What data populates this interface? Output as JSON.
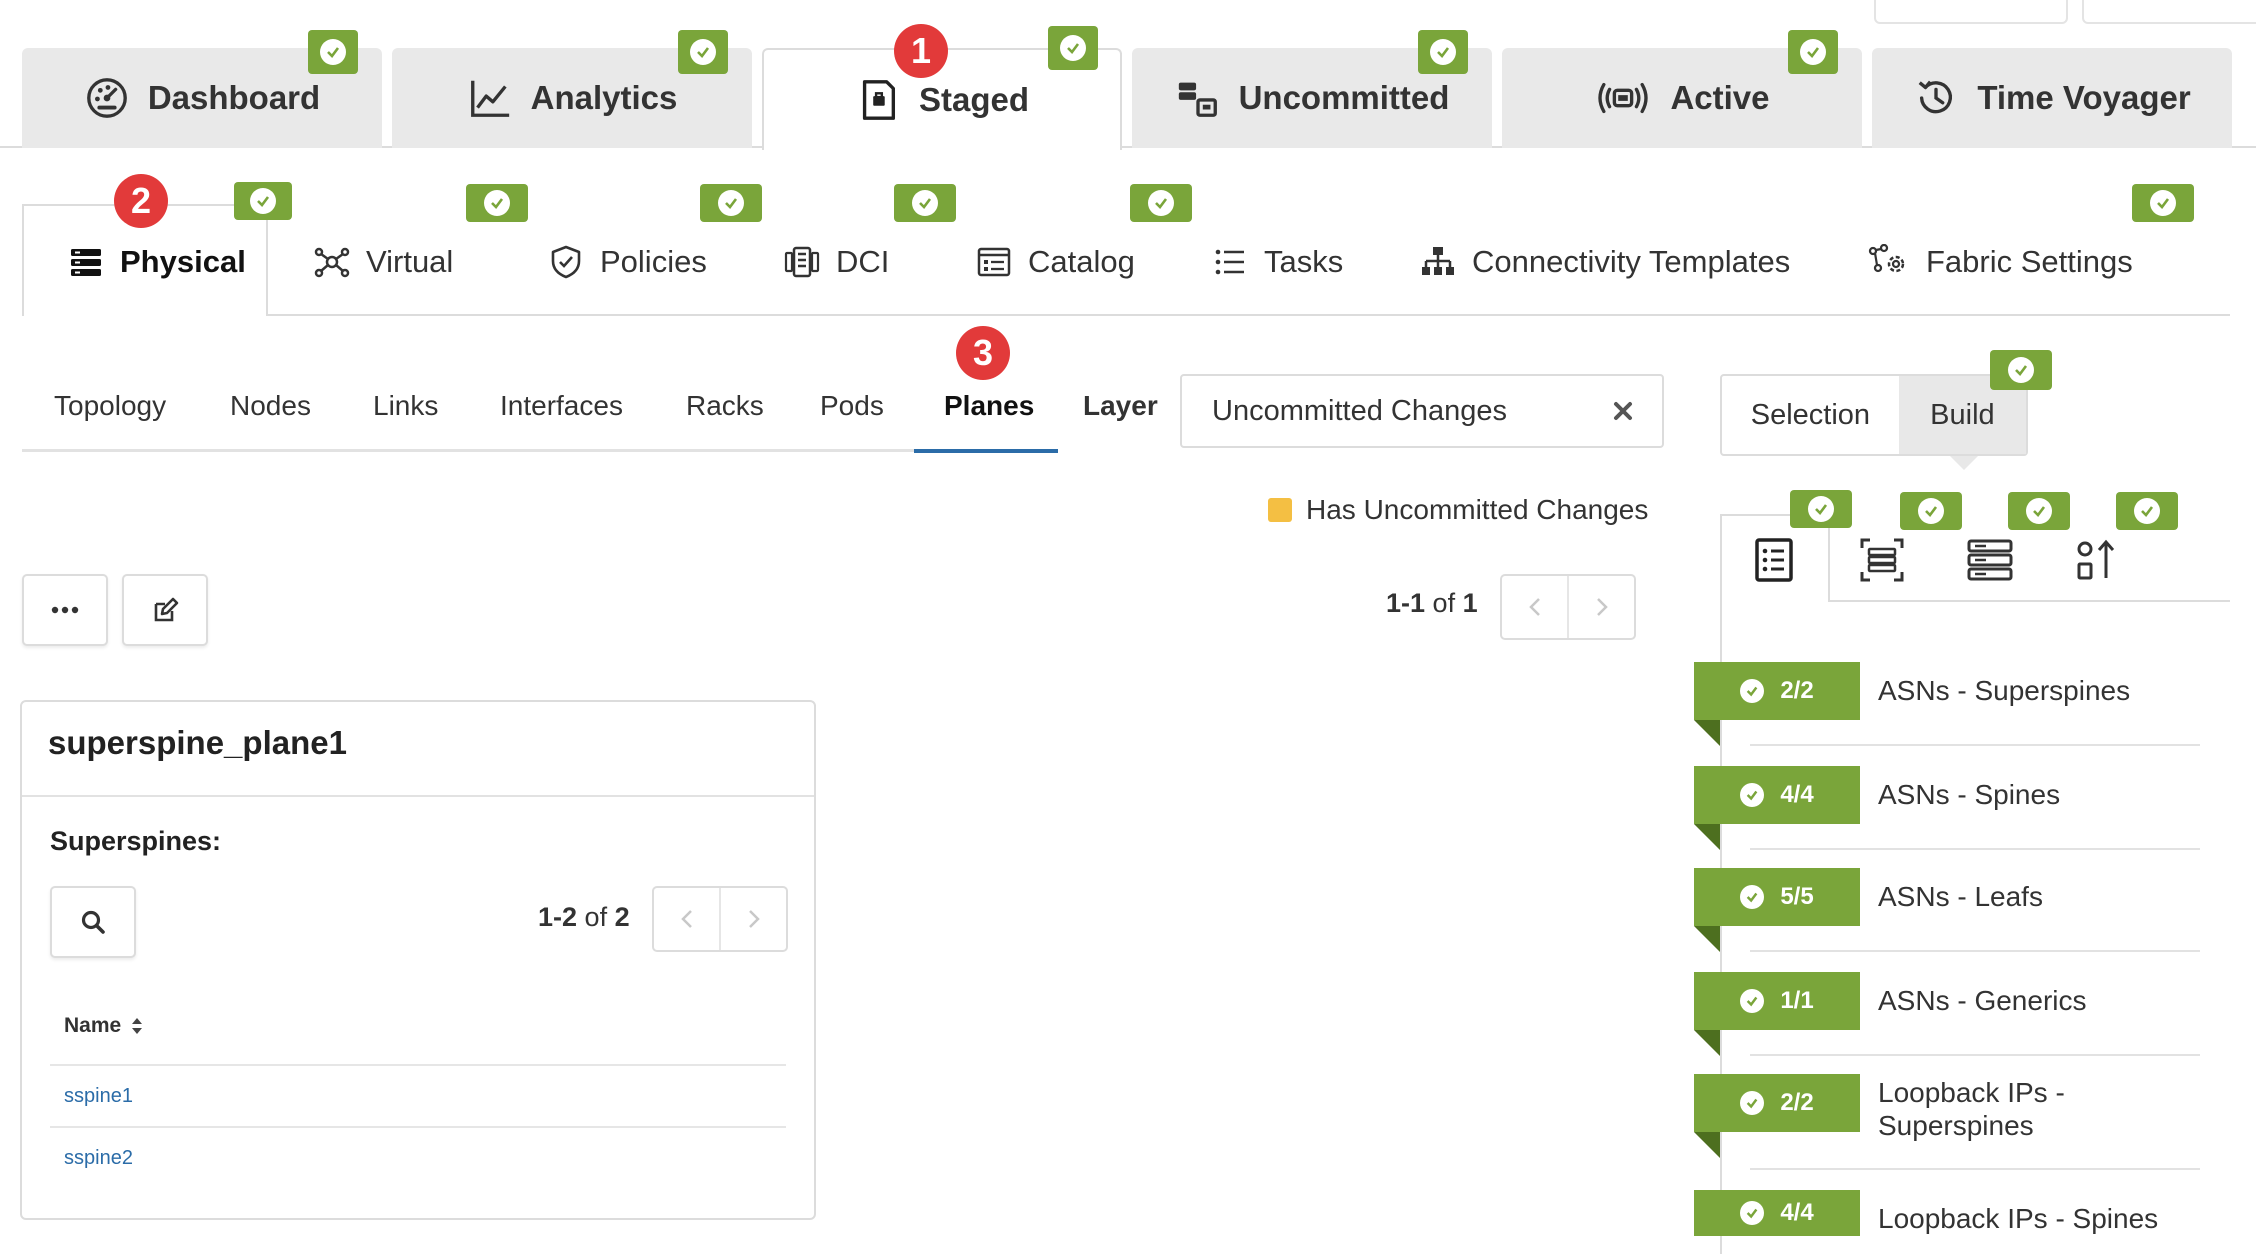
{
  "colors": {
    "accent_green": "#7aa53a",
    "step_red": "#e23a3a",
    "link_blue": "#2b6ca8",
    "uncommitted_legend": "#f4bf43"
  },
  "main_tabs": [
    {
      "label": "Dashboard",
      "icon": "dashboard-gauge-icon"
    },
    {
      "label": "Analytics",
      "icon": "analytics-line-chart-icon"
    },
    {
      "label": "Staged",
      "icon": "staged-document-icon",
      "active": true
    },
    {
      "label": "Uncommitted",
      "icon": "uncommitted-boxes-icon"
    },
    {
      "label": "Active",
      "icon": "active-broadcast-icon"
    },
    {
      "label": "Time Voyager",
      "icon": "time-voyager-history-icon"
    }
  ],
  "steps": [
    "1",
    "2",
    "3"
  ],
  "sub_tabs": [
    {
      "label": "Physical",
      "icon": "physical-server-icon",
      "active": true
    },
    {
      "label": "Virtual",
      "icon": "virtual-network-icon"
    },
    {
      "label": "Policies",
      "icon": "policies-shield-icon"
    },
    {
      "label": "DCI",
      "icon": "dci-interconnect-icon"
    },
    {
      "label": "Catalog",
      "icon": "catalog-icon"
    },
    {
      "label": "Tasks",
      "icon": "tasks-list-icon"
    },
    {
      "label": "Connectivity Templates",
      "icon": "connectivity-templates-icon"
    },
    {
      "label": "Fabric Settings",
      "icon": "fabric-settings-gear-icon"
    }
  ],
  "physical_tabs": [
    "Topology",
    "Nodes",
    "Links",
    "Interfaces",
    "Racks",
    "Pods",
    "Planes",
    "Layer"
  ],
  "active_physical_tab": "Planes",
  "layer_filter": {
    "value": "Uncommitted Changes"
  },
  "legend": {
    "label": "Has Uncommitted Changes"
  },
  "pagination": {
    "range": "1-1",
    "of": "of",
    "total": "1"
  },
  "plane": {
    "title": "superspine_plane1",
    "section_label": "Superspines:",
    "pagination": {
      "range": "1-2",
      "of": "of",
      "total": "2"
    },
    "column_name": "Name",
    "rows": [
      "sspine1",
      "sspine2"
    ]
  },
  "right_panel": {
    "mode_selection": "Selection",
    "mode_build": "Build",
    "panel_tabs": [
      "build-list-icon",
      "build-rack-icon",
      "build-devices-icon",
      "build-sort-icon"
    ],
    "items": [
      {
        "count": "2/2",
        "label": "ASNs - Superspines"
      },
      {
        "count": "4/4",
        "label": "ASNs - Spines"
      },
      {
        "count": "5/5",
        "label": "ASNs - Leafs"
      },
      {
        "count": "1/1",
        "label": "ASNs - Generics"
      },
      {
        "count": "2/2",
        "label": "Loopback IPs - Superspines"
      },
      {
        "count": "4/4",
        "label": "Loopback IPs - Spines"
      }
    ]
  }
}
